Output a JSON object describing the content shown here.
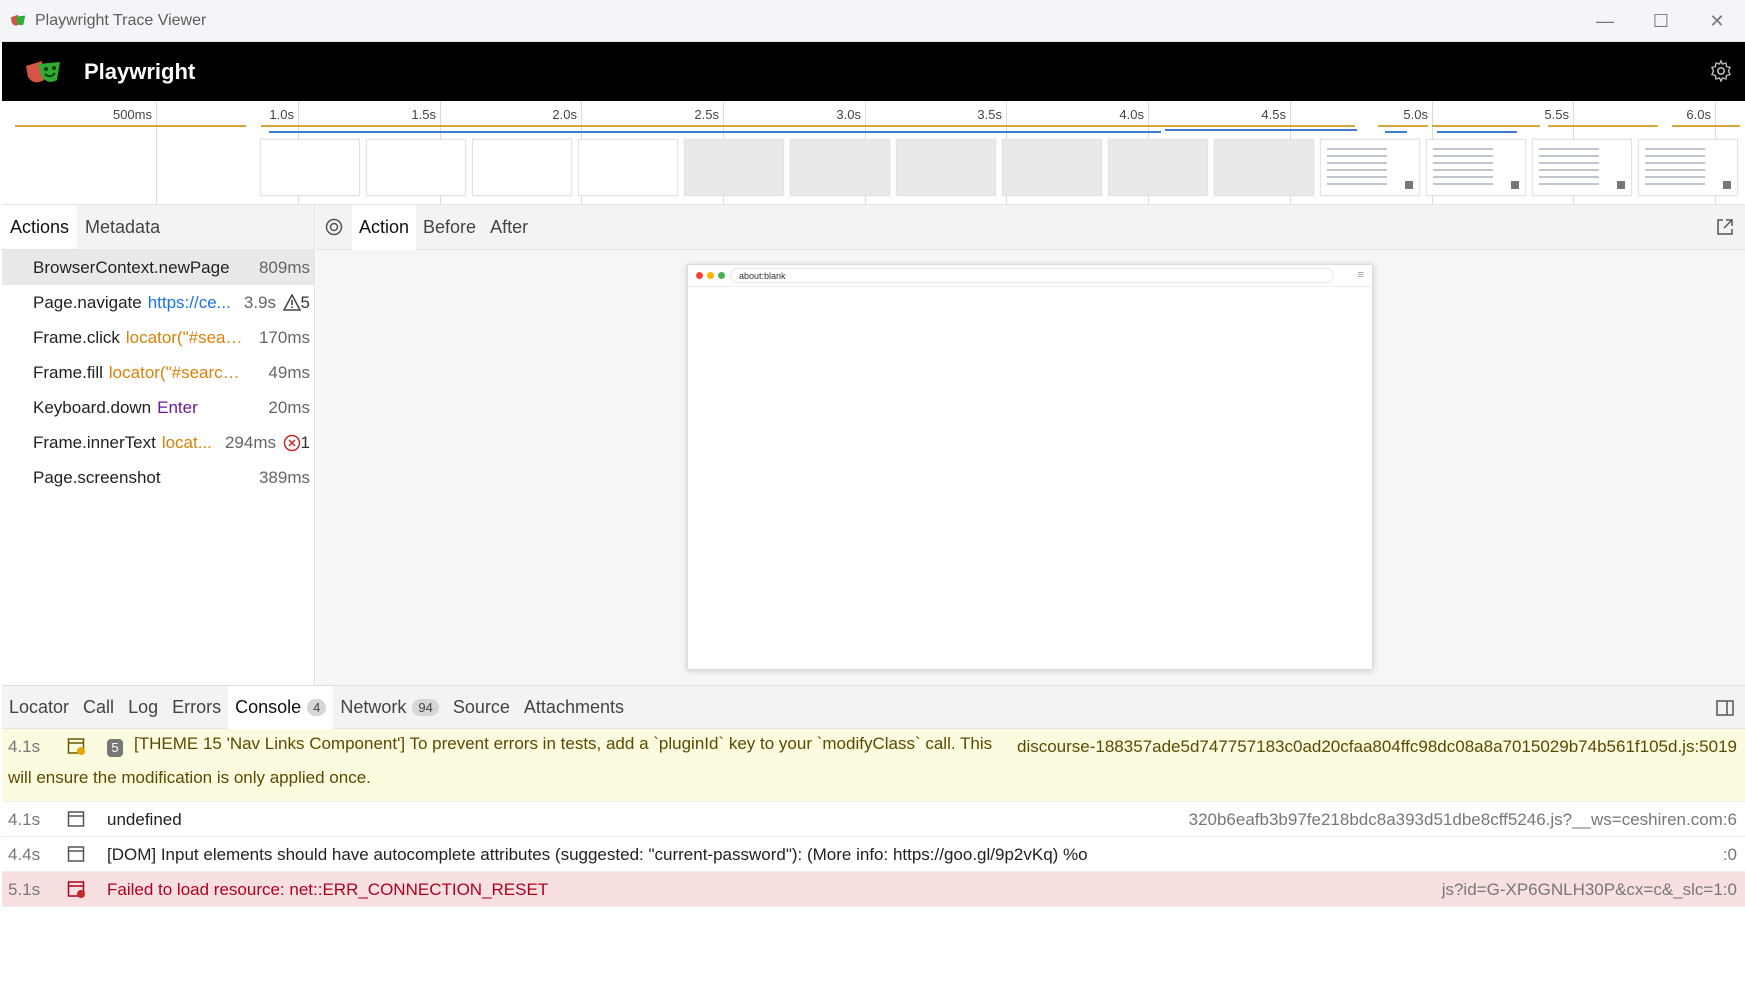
{
  "window": {
    "title": "Playwright Trace Viewer",
    "minimize_glyph": "—",
    "maximize_glyph": "☐",
    "close_glyph": "✕"
  },
  "header": {
    "brand": "Playwright"
  },
  "timeline": {
    "ticks": [
      "500ms",
      "1.0s",
      "1.5s",
      "2.0s",
      "2.5s",
      "3.0s",
      "3.5s",
      "4.0s",
      "4.5s",
      "5.0s",
      "5.5s",
      "6.0s"
    ]
  },
  "left": {
    "tabs": [
      "Actions",
      "Metadata"
    ],
    "actions": [
      {
        "name": "BrowserContext.newPage",
        "param": "",
        "duration": "809ms"
      },
      {
        "name": "Page.navigate",
        "param": "https://ce...",
        "duration": "3.9s",
        "warnings": "5"
      },
      {
        "name": "Frame.click",
        "param": "locator(\"#sear...",
        "duration": "170ms"
      },
      {
        "name": "Frame.fill",
        "param": "locator(\"#search-...",
        "duration": "49ms"
      },
      {
        "name": "Keyboard.down",
        "param": "Enter",
        "duration": "20ms"
      },
      {
        "name": "Frame.innerText",
        "param": "locat...",
        "duration": "294ms",
        "errors": "1"
      },
      {
        "name": "Page.screenshot",
        "param": "",
        "duration": "389ms"
      }
    ]
  },
  "right": {
    "tabs": [
      "Action",
      "Before",
      "After"
    ],
    "snapshot_url": "about:blank",
    "snapshot_menu_glyph": "≡"
  },
  "bottom": {
    "tabs": {
      "locator": "Locator",
      "call": "Call",
      "log": "Log",
      "errors": "Errors",
      "console": "Console",
      "console_count": "4",
      "network": "Network",
      "network_count": "94",
      "source": "Source",
      "attachments": "Attachments"
    },
    "logs": [
      {
        "time": "4.1s",
        "group_count": "5",
        "message": "[THEME 15 'Nav Links Component'] To prevent errors in tests, add a `pluginId` key to your `modifyClass` call. This will ensure the modification is only applied once.",
        "source": "discourse-188357ade5d747757183c0ad20cfaa804ffc98dc08a8a7015029b74b561f105d.js:5019"
      },
      {
        "time": "4.1s",
        "message": "undefined",
        "source": "320b6eafb3b97fe218bdc8a393d51dbe8cff5246.js?__ws=ceshiren.com:6"
      },
      {
        "time": "4.4s",
        "message": "[DOM] Input elements should have autocomplete attributes (suggested: \"current-password\"): (More info: https://goo.gl/9p2vKq) %o",
        "source": ":0"
      },
      {
        "time": "5.1s",
        "message": "Failed to load resource: net::ERR_CONNECTION_RESET",
        "source": "js?id=G-XP6GNLH30P&cx=c&_slc=1:0"
      }
    ]
  },
  "colors": {
    "accent_orange": "#d8820a",
    "accent_blue": "#1a73e8",
    "warn_bg": "#fbfbe0",
    "error_bg": "#f8e0e0"
  }
}
